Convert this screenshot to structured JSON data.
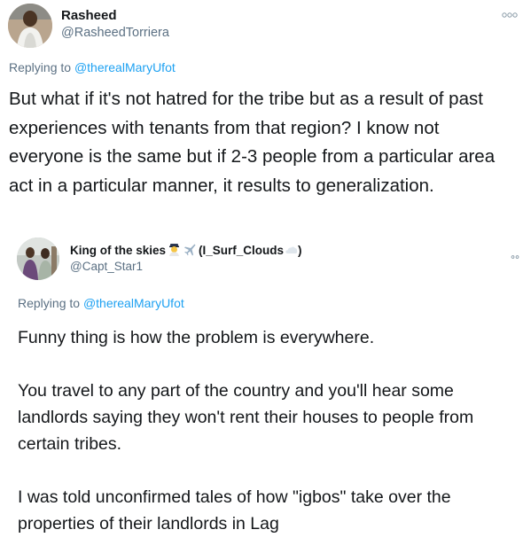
{
  "tweet": {
    "author_name": "Rasheed",
    "author_handle": "@RasheedTorriera",
    "replying_prefix": "Replying to ",
    "replying_to": "@therealMaryUfot",
    "text": "But what if it's not hatred for the tribe but as a result of past experiences with tenants from that region? I know not everyone is the same but if 2-3 people from a particular area act in a particular manner, it results to generalization."
  },
  "quoted_tweet": {
    "author_name_start": "King of the skies",
    "author_name_mid": "(I_Surf_Clouds",
    "author_name_end": ")",
    "author_handle": "@Capt_Star1",
    "replying_prefix": "Replying to ",
    "replying_to": "@therealMaryUfot",
    "paragraphs": [
      "Funny thing is how the problem is everywhere.",
      "You travel to any part of the country and you'll hear some landlords saying they won't rent their houses to people from certain tribes.",
      "I was told unconfirmed tales of how \"igbos\" take over the properties of their landlords in Lag"
    ]
  },
  "icons": {
    "more": "more-options-icon",
    "pilot": "pilot-emoji-icon",
    "airplane": "airplane-emoji-icon",
    "cloud": "cloud-emoji-icon"
  },
  "colors": {
    "text": "#14171a",
    "secondary": "#5b7083",
    "link": "#1da1f2"
  }
}
